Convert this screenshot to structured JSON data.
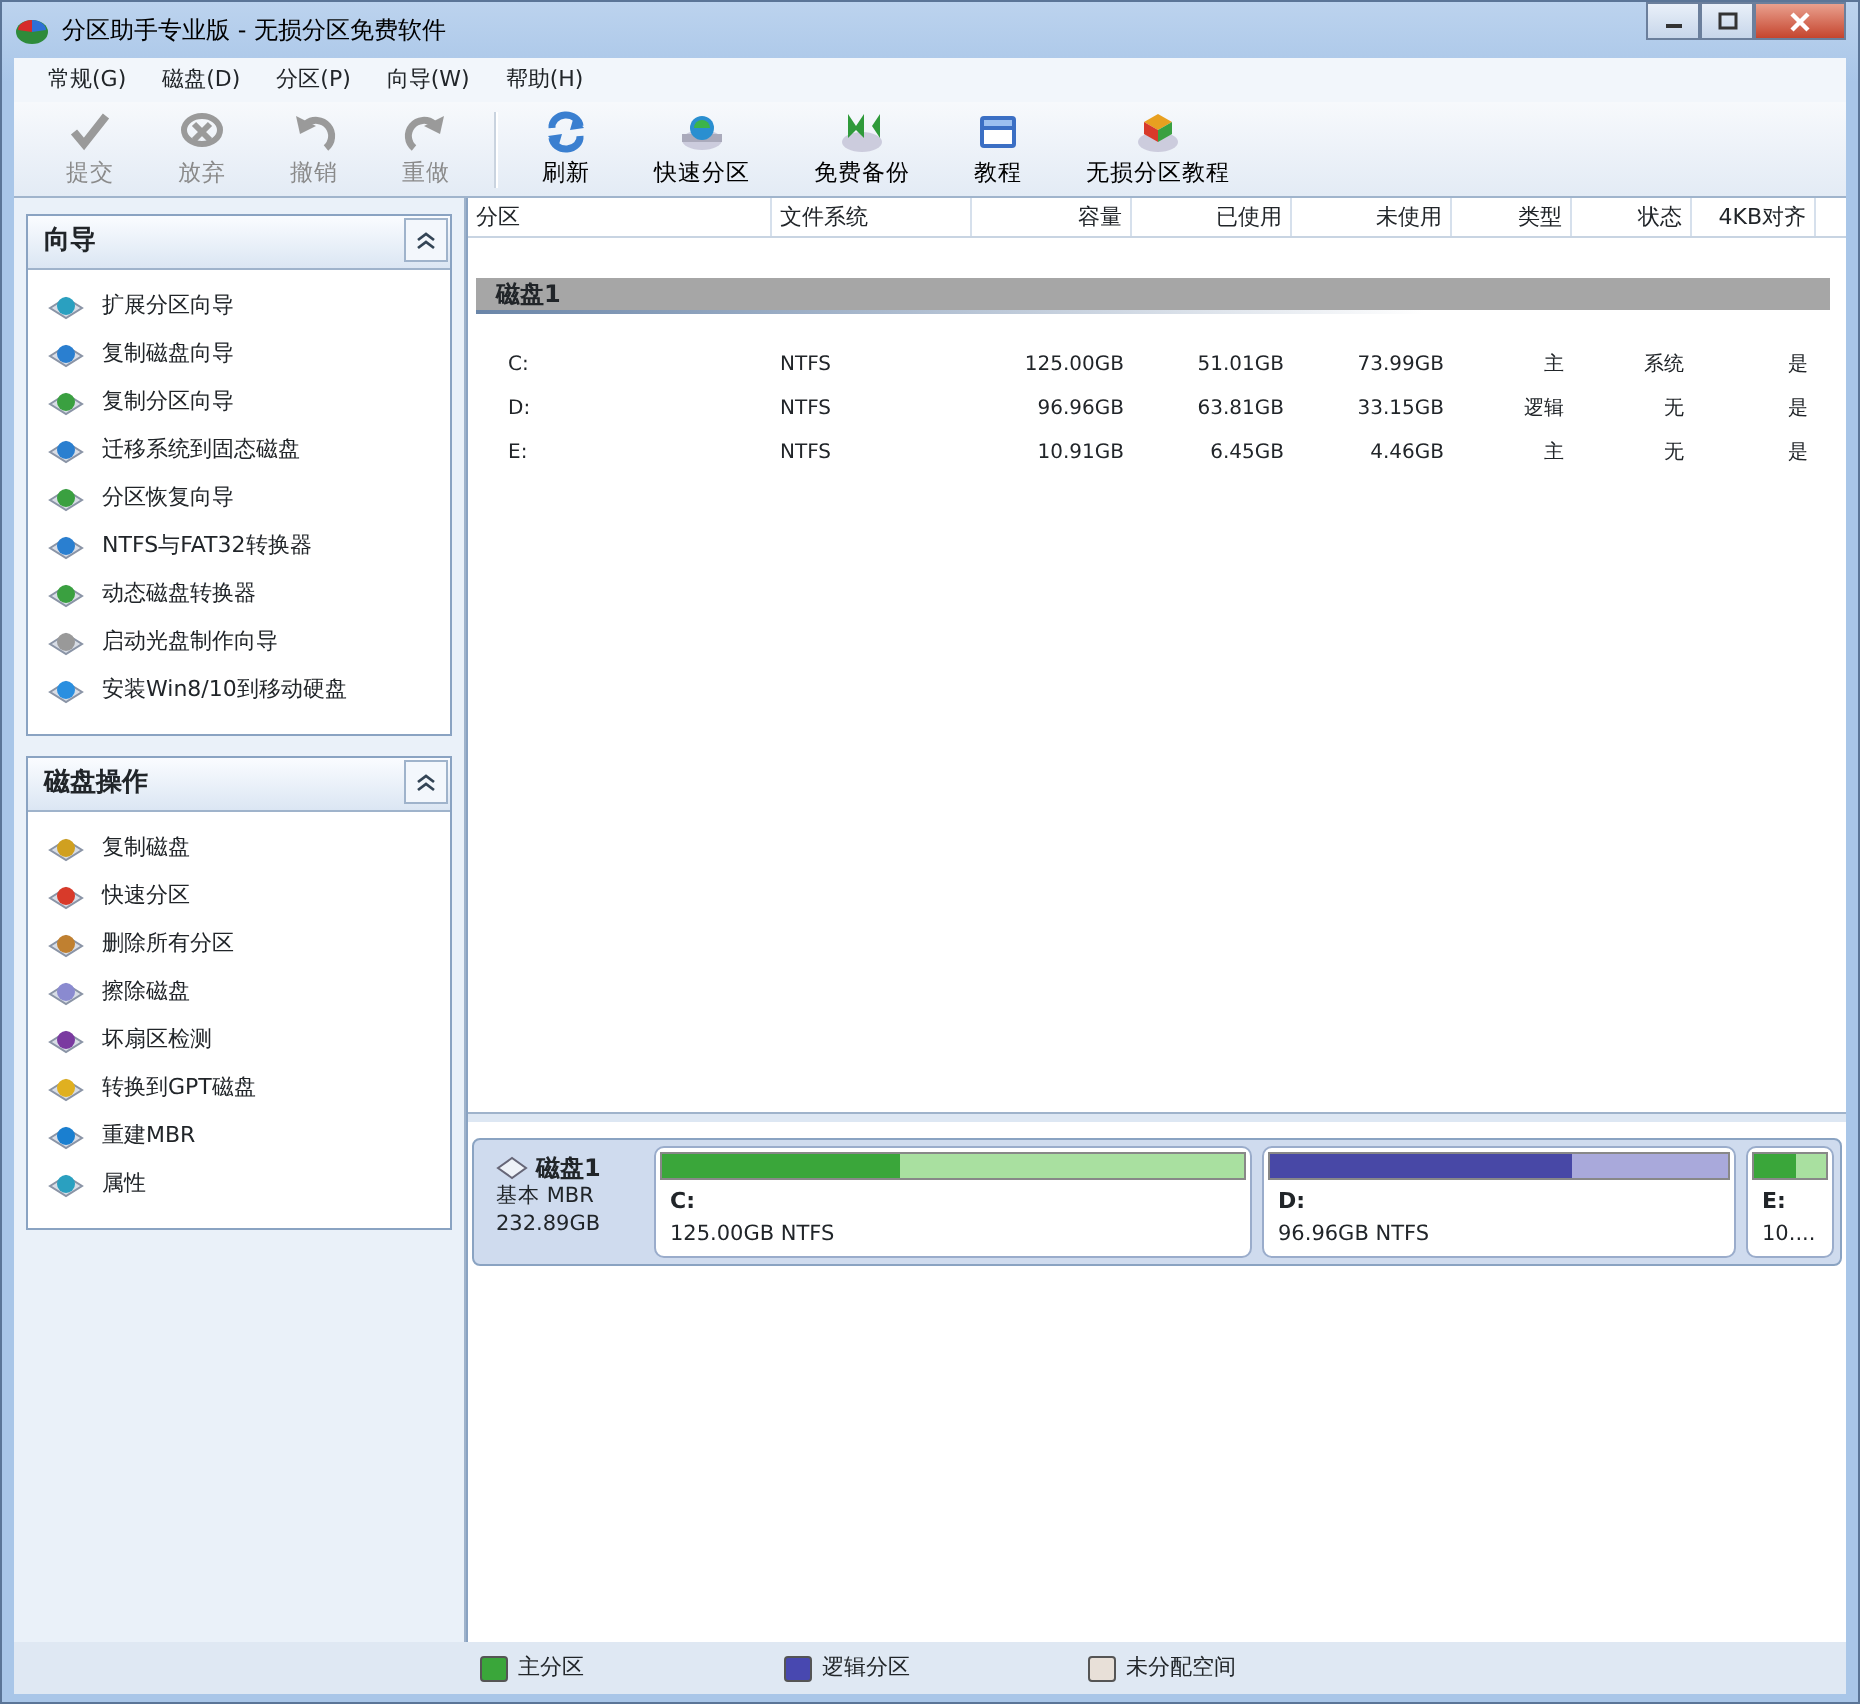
{
  "window": {
    "title": "分区助手专业版 - 无损分区免费软件"
  },
  "menu": [
    {
      "label": "常规(G)"
    },
    {
      "label": "磁盘(D)"
    },
    {
      "label": "分区(P)"
    },
    {
      "label": "向导(W)"
    },
    {
      "label": "帮助(H)"
    }
  ],
  "toolbar": [
    {
      "kind": "commit",
      "label": "提交",
      "disabled": true
    },
    {
      "kind": "discard",
      "label": "放弃",
      "disabled": true
    },
    {
      "kind": "undo",
      "label": "撤销",
      "disabled": true
    },
    {
      "kind": "redo",
      "label": "重做",
      "disabled": true
    },
    {
      "kind": "refresh",
      "label": "刷新",
      "disabled": false
    },
    {
      "kind": "quick",
      "label": "快速分区",
      "disabled": false
    },
    {
      "kind": "backup",
      "label": "免费备份",
      "disabled": false
    },
    {
      "kind": "tutorial",
      "label": "教程",
      "disabled": false
    },
    {
      "kind": "guide",
      "label": "无损分区教程",
      "disabled": false
    }
  ],
  "sidebar": [
    {
      "title": "向导",
      "expanded": true,
      "items": [
        {
          "label": "扩展分区向导"
        },
        {
          "label": "复制磁盘向导"
        },
        {
          "label": "复制分区向导"
        },
        {
          "label": "迁移系统到固态磁盘"
        },
        {
          "label": "分区恢复向导"
        },
        {
          "label": "NTFS与FAT32转换器"
        },
        {
          "label": "动态磁盘转换器"
        },
        {
          "label": "启动光盘制作向导"
        },
        {
          "label": "安装Win8/10到移动硬盘"
        }
      ]
    },
    {
      "title": "磁盘操作",
      "expanded": true,
      "items": [
        {
          "label": "复制磁盘"
        },
        {
          "label": "快速分区"
        },
        {
          "label": "删除所有分区"
        },
        {
          "label": "擦除磁盘"
        },
        {
          "label": "坏扇区检测"
        },
        {
          "label": "转换到GPT磁盘"
        },
        {
          "label": "重建MBR"
        },
        {
          "label": "属性"
        }
      ]
    }
  ],
  "table": {
    "columns": [
      "分区",
      "文件系统",
      "容量",
      "已使用",
      "未使用",
      "类型",
      "状态",
      "4KB对齐"
    ],
    "groups": [
      {
        "title": "磁盘1",
        "rows": [
          [
            "C:",
            "NTFS",
            "125.00GB",
            "51.01GB",
            "73.99GB",
            "主",
            "系统",
            "是"
          ],
          [
            "D:",
            "NTFS",
            "96.96GB",
            "63.81GB",
            "33.15GB",
            "逻辑",
            "无",
            "是"
          ],
          [
            "E:",
            "NTFS",
            "10.91GB",
            "6.45GB",
            "4.46GB",
            "主",
            "无",
            "是"
          ]
        ]
      }
    ]
  },
  "disk_map": [
    {
      "name": "磁盘1",
      "type": "基本 MBR",
      "size": "232.89GB",
      "partitions": [
        {
          "kind": "primary",
          "letter": "C:",
          "info": "125.00GB NTFS",
          "level": 0.41
        },
        {
          "kind": "logical",
          "letter": "D:",
          "info": "96.96GB NTFS",
          "level": 0.66
        },
        {
          "kind": "primary",
          "letter": "E:",
          "info": "10....",
          "level": 0.59
        }
      ]
    }
  ],
  "legend": [
    {
      "label": "主分区",
      "color": "#3aa63a"
    },
    {
      "label": "逻辑分区",
      "color": "#4848b0"
    },
    {
      "label": "未分配空间",
      "color": "#e8e0d8"
    }
  ]
}
